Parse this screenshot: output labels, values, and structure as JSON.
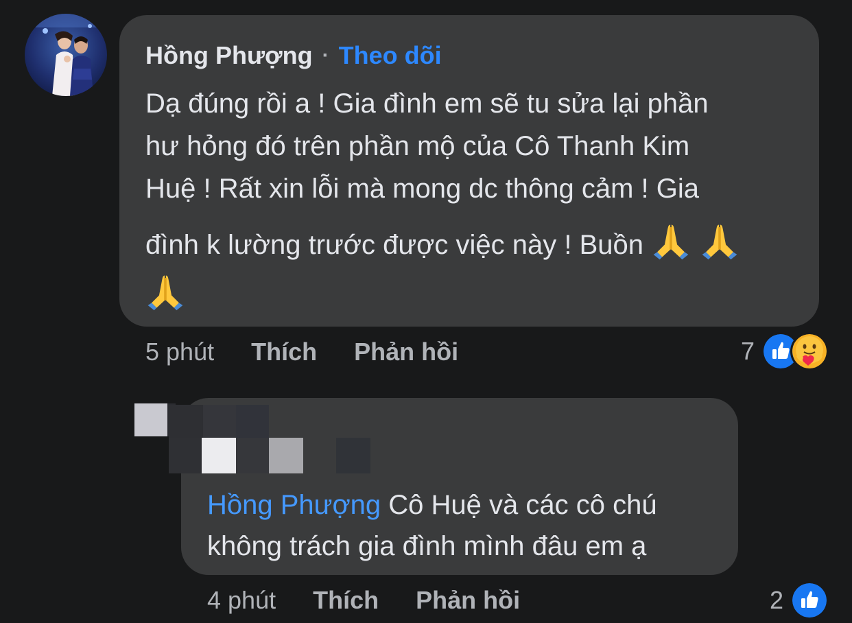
{
  "main_comment": {
    "author": "Hồng Phượng",
    "separator": "·",
    "follow_label": "Theo dõi",
    "text_lines": [
      "Dạ đúng rồi a ! Gia đình em sẽ tu sửa lại phần",
      "hư hỏng đó trên phần mộ của Cô Thanh Kim",
      "Huệ ! Rất xin lỗi mà mong dc thông cảm ! Gia",
      "đình k lường trước được việc này ! Buồn"
    ],
    "emoji_icons": [
      "folded-hands-icon",
      "folded-hands-icon",
      "folded-hands-icon"
    ],
    "time": "5 phút",
    "like_label": "Thích",
    "reply_label": "Phản hồi",
    "reaction_count": "7",
    "reaction_icons": [
      "like-icon",
      "care-icon"
    ]
  },
  "reply_comment": {
    "mention": "Hồng Phượng",
    "text": " Cô Huệ và các cô chú không trách gia đình mình đâu em ạ",
    "time": "4 phút",
    "like_label": "Thích",
    "reply_label": "Phản hồi",
    "reaction_count": "2",
    "reaction_icons": [
      "like-icon"
    ]
  },
  "colors": {
    "background": "#18191a",
    "bubble": "#3a3b3c",
    "primary_text": "#e4e6eb",
    "secondary_text": "#b0b3b8",
    "link_blue": "#2d88ff",
    "like_blue": "#1877f2"
  }
}
